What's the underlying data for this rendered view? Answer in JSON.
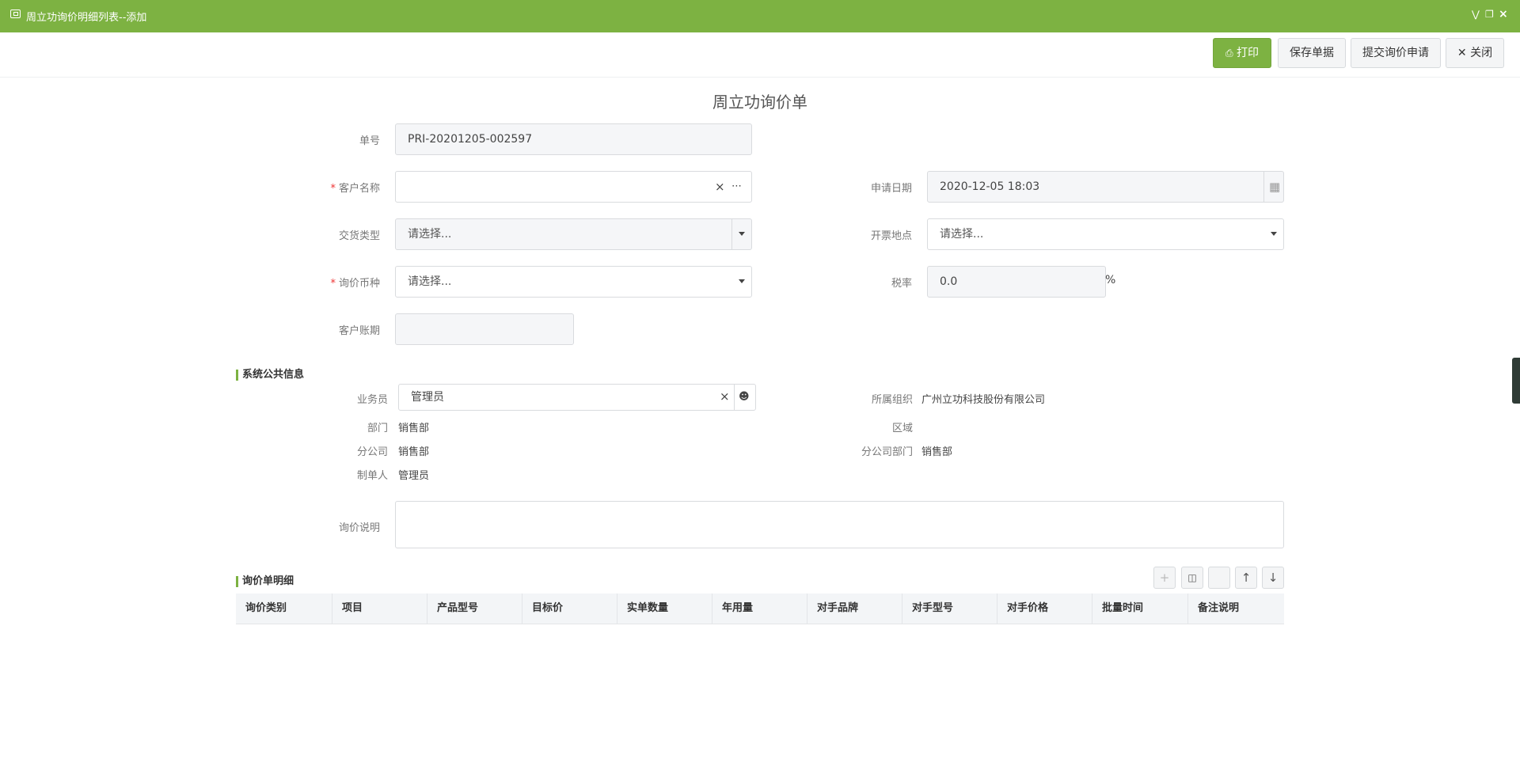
{
  "window": {
    "title": "周立功询价明细列表--添加"
  },
  "toolbar": {
    "print_label": "打印",
    "save_label": "保存单据",
    "submit_label": "提交询价申请",
    "close_label": "关闭"
  },
  "form": {
    "title": "周立功询价单",
    "order_no_label": "单号",
    "order_no_value": "PRI-20201205-002597",
    "customer_label": "客户名称",
    "customer_value": "",
    "apply_date_label": "申请日期",
    "apply_date_value": "2020-12-05 18:03",
    "delivery_type_label": "交货类型",
    "delivery_type_placeholder": "请选择...",
    "invoice_place_label": "开票地点",
    "invoice_place_placeholder": "请选择...",
    "currency_label": "询价币种",
    "currency_placeholder": "请选择...",
    "tax_label": "税率",
    "tax_value": "0.0",
    "tax_unit": "%",
    "account_period_label": "客户账期",
    "account_period_value": ""
  },
  "system_info": {
    "section_title": "系统公共信息",
    "salesman_label": "业务员",
    "salesman_value": "管理员",
    "org_label": "所属组织",
    "org_value": "广州立功科技股份有限公司",
    "dept_label": "部门",
    "dept_value": "销售部",
    "region_label": "区域",
    "region_value": "",
    "branch_label": "分公司",
    "branch_value": "销售部",
    "branch_dept_label": "分公司部门",
    "branch_dept_value": "销售部",
    "creator_label": "制单人",
    "creator_value": "管理员",
    "remark_label": "询价说明",
    "remark_value": ""
  },
  "details": {
    "section_title": "询价单明细",
    "columns": [
      "询价类别",
      "项目",
      "产品型号",
      "目标价",
      "实单数量",
      "年用量",
      "对手品牌",
      "对手型号",
      "对手价格",
      "批量时间",
      "备注说明"
    ]
  },
  "colors": {
    "accent": "#7db242",
    "required": "#ee3333"
  }
}
